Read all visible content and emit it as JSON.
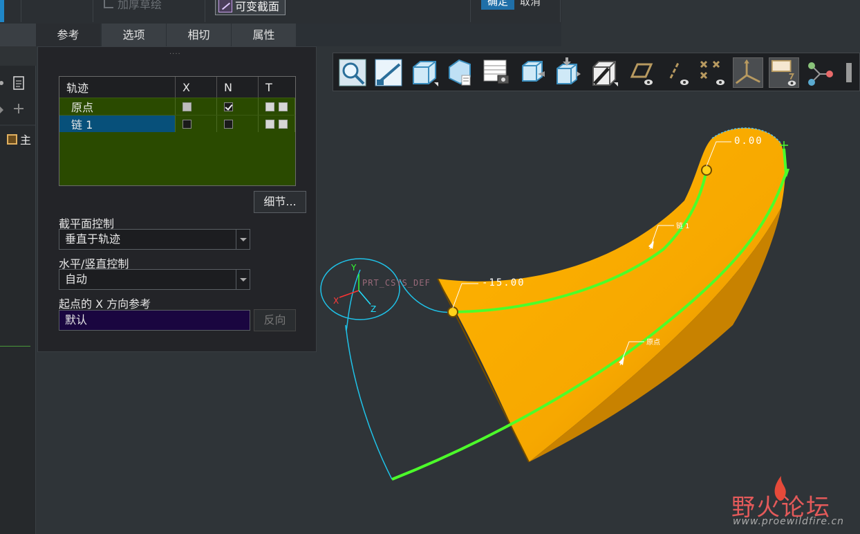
{
  "ribbon": {
    "thicken_sketch_label": "加厚草绘",
    "variable_section_label": "可变截面",
    "ok_label": "确定",
    "cancel_label": "取消"
  },
  "tabs": [
    {
      "label": "参考",
      "active": true
    },
    {
      "label": "选项",
      "active": false
    },
    {
      "label": "相切",
      "active": false
    },
    {
      "label": "属性",
      "active": false
    }
  ],
  "tree": {
    "item_label": "主"
  },
  "panel": {
    "grip": "....",
    "table": {
      "headers": [
        "轨迹",
        "X",
        "N",
        "T"
      ],
      "rows": [
        {
          "name": "原点",
          "x": "grey",
          "n": "checked",
          "selected": false
        },
        {
          "name": "链 1",
          "x": "unchecked",
          "n": "unchecked",
          "selected": true
        }
      ]
    },
    "detail_button": "细节...",
    "section_plane_control_label": "截平面控制",
    "section_plane_control_value": "垂直于轨迹",
    "horizontal_vertical_control_label": "水平/竖直控制",
    "horizontal_vertical_control_value": "自动",
    "start_x_direction_label": "起点的 X 方向参考",
    "start_x_direction_value": "默认",
    "flip_button": "反向"
  },
  "viewport": {
    "dimension_top": "0.00",
    "dimension_start": "-15.00",
    "chain_label": "链 1",
    "origin_label": "原点",
    "csys_label": "PRT_CSYS_DEF",
    "axis_x": "X",
    "axis_y": "Y",
    "axis_z": "Z",
    "colors": {
      "surface": "#f7a800",
      "trajectory": "#4cff2a",
      "sketch": "#1fc2e8",
      "handle": "#ffd21a"
    }
  },
  "watermark": {
    "title": "野火论坛",
    "url": "www.proewildfire.cn"
  }
}
